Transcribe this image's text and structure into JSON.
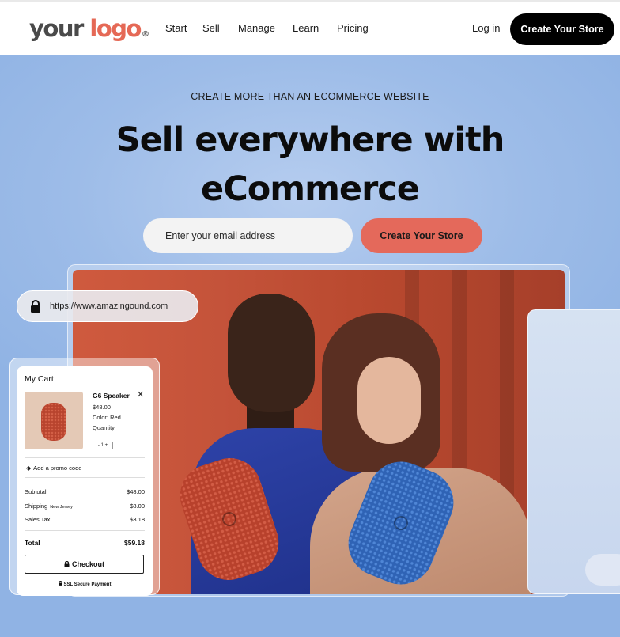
{
  "header": {
    "logo_word1": "your",
    "logo_word2": "logo",
    "logo_mark": "®",
    "nav": [
      "Start",
      "Sell",
      "Manage",
      "Learn",
      "Pricing"
    ],
    "login_label": "Log in",
    "cta_label": "Create Your Store"
  },
  "hero": {
    "eyebrow": "CREATE MORE THAN AN ECOMMERCE WEBSITE",
    "headline_line1": "Sell everywhere with",
    "headline_line2": "eCommerce",
    "email_placeholder": "Enter your email address",
    "cta_label": "Create Your Store"
  },
  "browser": {
    "url": "https://www.amazingound.com",
    "lock_icon": "lock-icon"
  },
  "cart": {
    "title": "My Cart",
    "product_name": "G6 Speaker",
    "product_price": "$48.00",
    "product_color": "Color: Red",
    "quantity_label": "Quantity",
    "quantity_value": "1",
    "promo_label": "Add a promo code",
    "subtotal_label": "Subtotal",
    "subtotal_value": "$48.00",
    "shipping_label": "Shipping",
    "shipping_region": "New Jersey",
    "shipping_value": "$8.00",
    "tax_label": "Sales Tax",
    "tax_value": "$3.18",
    "total_label": "Total",
    "total_value": "$59.18",
    "checkout_label": "Checkout",
    "ssl_label": "SSL Secure Payment"
  },
  "colors": {
    "brand_orange": "#e56956",
    "cta_hero": "#e4695b",
    "cta_top": "#000000",
    "hero_bg": "#9dbce8"
  }
}
